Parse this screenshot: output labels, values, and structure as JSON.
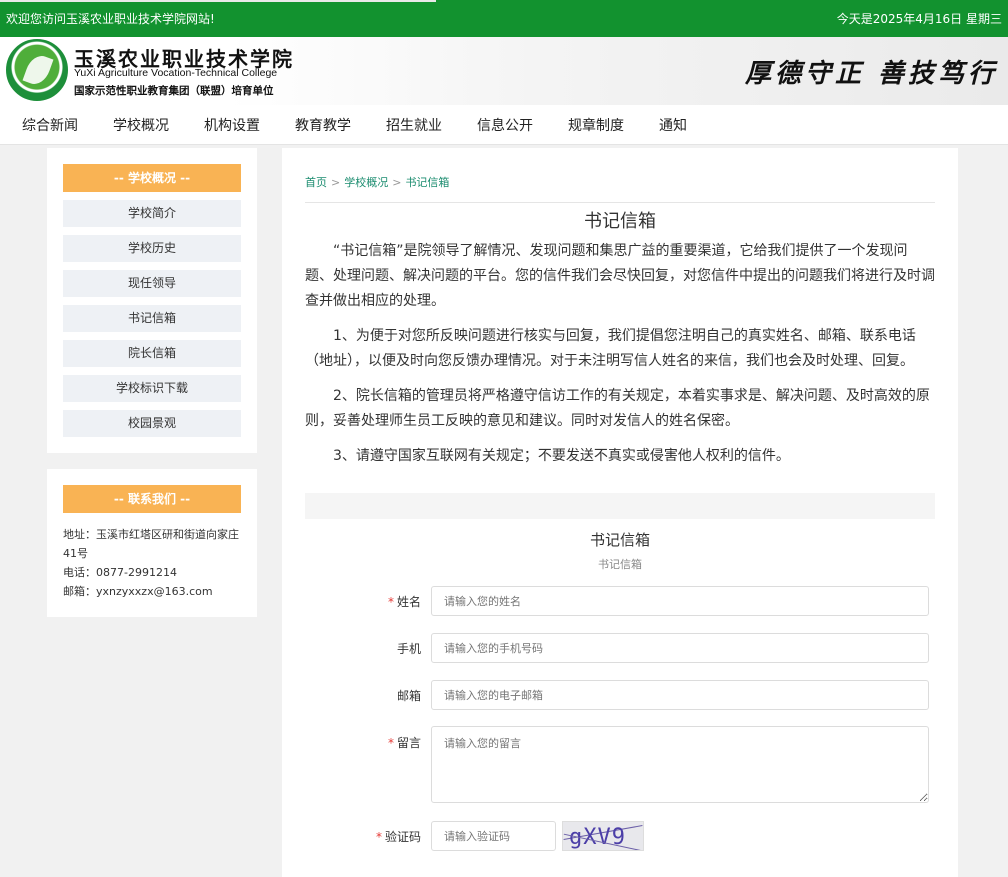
{
  "topbar": {
    "welcome": "欢迎您访问玉溪农业职业技术学院网站!",
    "date": "今天是2025年4月16日 星期三"
  },
  "header": {
    "school_cn": "玉溪农业职业技术学院",
    "school_en": "YuXi Agriculture Vocation-Technical College",
    "sub": "国家示范性职业教育集团（联盟）培育单位",
    "motto": "厚德守正 善技笃行"
  },
  "nav": [
    "综合新闻",
    "学校概况",
    "机构设置",
    "教育教学",
    "招生就业",
    "信息公开",
    "规章制度",
    "通知"
  ],
  "sidebar": {
    "overview_title": "-- 学校概况 --",
    "items": [
      "学校简介",
      "学校历史",
      "现任领导",
      "书记信箱",
      "院长信箱",
      "学校标识下载",
      "校园景观"
    ],
    "contact_title": "-- 联系我们 --",
    "address": "地址：玉溪市红塔区研和街道向家庄41号",
    "phone": "电话：0877-2991214",
    "email": "邮箱：yxnzyxxzx@163.com"
  },
  "breadcrumb": {
    "home": "首页",
    "sep": ">",
    "section": "学校概况",
    "current": "书记信箱"
  },
  "article": {
    "title": "书记信箱",
    "p1": "“书记信箱”是院领导了解情况、发现问题和集思广益的重要渠道，它给我们提供了一个发现问题、处理问题、解决问题的平台。您的信件我们会尽快回复，对您信件中提出的问题我们将进行及时调查并做出相应的处理。",
    "p2": "1、为便于对您所反映问题进行核实与回复，我们提倡您注明自己的真实姓名、邮箱、联系电话（地址），以便及时向您反馈办理情况。对于未注明写信人姓名的来信，我们也会及时处理、回复。",
    "p3": "2、院长信箱的管理员将严格遵守信访工作的有关规定，本着实事求是、解决问题、及时高效的原则，妥善处理师生员工反映的意见和建议。同时对发信人的姓名保密。",
    "p4": "3、请遵守国家互联网有关规定；不要发送不真实或侵害他人权利的信件。"
  },
  "form": {
    "title": "书记信箱",
    "subtitle": "书记信箱",
    "required_mark": "*",
    "name_label": "姓名",
    "name_ph": "请输入您的姓名",
    "phone_label": "手机",
    "phone_ph": "请输入您的手机号码",
    "email_label": "邮箱",
    "email_ph": "请输入您的电子邮箱",
    "msg_label": "留言",
    "msg_ph": "请输入您的留言",
    "captcha_label": "验证码",
    "captcha_ph": "请输入验证码",
    "captcha_text": "gXV9"
  }
}
